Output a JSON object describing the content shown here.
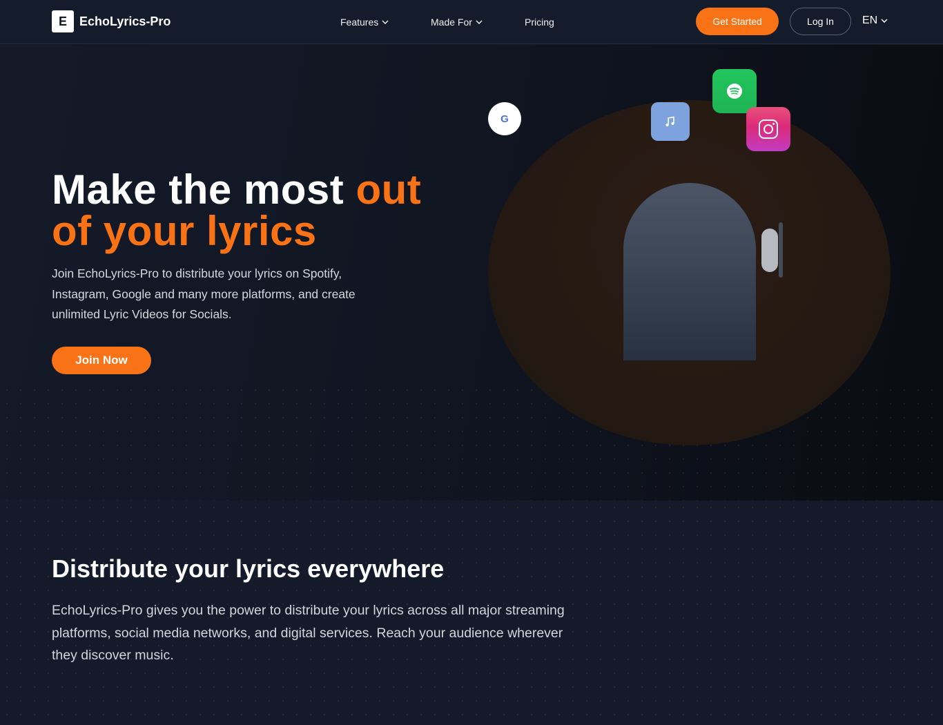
{
  "brand": {
    "logo_letter": "E",
    "name": "EchoLyrics-Pro"
  },
  "nav": {
    "features": "Features",
    "made_for": "Made For",
    "pricing": "Pricing",
    "get_started": "Get Started",
    "log_in": "Log In",
    "language": "EN"
  },
  "hero": {
    "title_white": "Make the most ",
    "title_orange_1": "out",
    "title_orange_2": "of your lyrics",
    "description": "Join EchoLyrics-Pro to distribute your lyrics on Spotify, Instagram, Google and many more platforms, and create unlimited Lyric Videos for Socials.",
    "join_button": "Join Now",
    "platform_icons": {
      "google": "G",
      "names": [
        "google-icon",
        "music-note-icon",
        "spotify-icon",
        "instagram-icon"
      ]
    }
  },
  "distribute": {
    "title": "Distribute your lyrics everywhere",
    "description": "EchoLyrics-Pro gives you the power to distribute your lyrics across all major streaming platforms, social media networks, and digital services. Reach your audience wherever they discover music."
  },
  "colors": {
    "accent": "#f97316",
    "background": "#111726",
    "spotify": "#22c55e",
    "instagram": "#dd2a7b",
    "music": "#7ea2de"
  }
}
